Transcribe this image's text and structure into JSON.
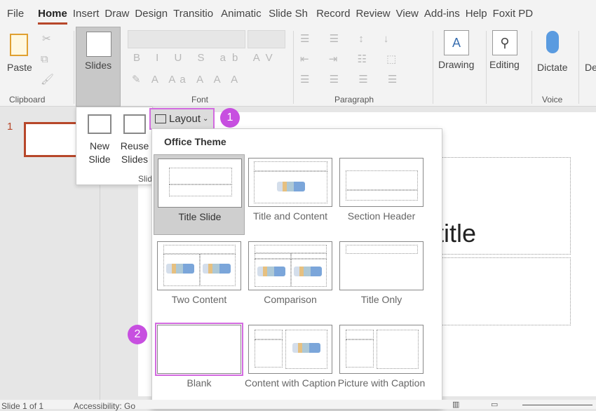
{
  "tabs": [
    "File",
    "Home",
    "Insert",
    "Draw",
    "Design",
    "Transitio",
    "Animatic",
    "Slide Sh",
    "Record",
    "Review",
    "View",
    "Add-ins",
    "Help",
    "Foxit PD"
  ],
  "ribbon": {
    "paste": "Paste",
    "clipboard": "Clipboard",
    "slides": "Slides",
    "font": "Font",
    "paragraph": "Paragraph",
    "drawing": "Drawing",
    "editing": "Editing",
    "dictate": "Dictate",
    "voice": "Voice",
    "designer": "De"
  },
  "slides_menu": {
    "new_slide": "New Slide",
    "reuse_slides": "Reuse Slides",
    "group": "Slid"
  },
  "layout_button": "Layout",
  "badge1": "1",
  "badge2": "2",
  "gallery": {
    "title": "Office Theme",
    "items": [
      {
        "label": "Title Slide"
      },
      {
        "label": "Title and Content"
      },
      {
        "label": "Section Header"
      },
      {
        "label": "Two Content"
      },
      {
        "label": "Comparison"
      },
      {
        "label": "Title Only"
      },
      {
        "label": "Blank"
      },
      {
        "label": "Content with Caption"
      },
      {
        "label": "Picture with Caption"
      }
    ]
  },
  "thumbnail_number": "1",
  "slide_text": "title",
  "status": {
    "slide": "Slide 1 of 1",
    "accessibility": "Accessibility: Go"
  },
  "colors": {
    "accent": "#b7472a",
    "highlight": "#c74fe0"
  }
}
